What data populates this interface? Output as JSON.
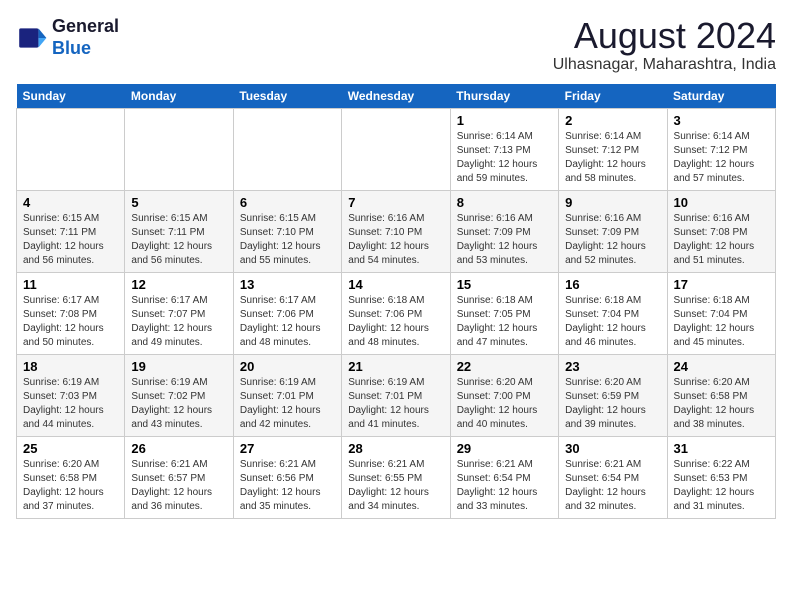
{
  "logo": {
    "line1": "General",
    "line2": "Blue"
  },
  "title": "August 2024",
  "subtitle": "Ulhasnagar, Maharashtra, India",
  "days_of_week": [
    "Sunday",
    "Monday",
    "Tuesday",
    "Wednesday",
    "Thursday",
    "Friday",
    "Saturday"
  ],
  "weeks": [
    [
      {
        "day": "",
        "info": ""
      },
      {
        "day": "",
        "info": ""
      },
      {
        "day": "",
        "info": ""
      },
      {
        "day": "",
        "info": ""
      },
      {
        "day": "1",
        "info": "Sunrise: 6:14 AM\nSunset: 7:13 PM\nDaylight: 12 hours\nand 59 minutes."
      },
      {
        "day": "2",
        "info": "Sunrise: 6:14 AM\nSunset: 7:12 PM\nDaylight: 12 hours\nand 58 minutes."
      },
      {
        "day": "3",
        "info": "Sunrise: 6:14 AM\nSunset: 7:12 PM\nDaylight: 12 hours\nand 57 minutes."
      }
    ],
    [
      {
        "day": "4",
        "info": "Sunrise: 6:15 AM\nSunset: 7:11 PM\nDaylight: 12 hours\nand 56 minutes."
      },
      {
        "day": "5",
        "info": "Sunrise: 6:15 AM\nSunset: 7:11 PM\nDaylight: 12 hours\nand 56 minutes."
      },
      {
        "day": "6",
        "info": "Sunrise: 6:15 AM\nSunset: 7:10 PM\nDaylight: 12 hours\nand 55 minutes."
      },
      {
        "day": "7",
        "info": "Sunrise: 6:16 AM\nSunset: 7:10 PM\nDaylight: 12 hours\nand 54 minutes."
      },
      {
        "day": "8",
        "info": "Sunrise: 6:16 AM\nSunset: 7:09 PM\nDaylight: 12 hours\nand 53 minutes."
      },
      {
        "day": "9",
        "info": "Sunrise: 6:16 AM\nSunset: 7:09 PM\nDaylight: 12 hours\nand 52 minutes."
      },
      {
        "day": "10",
        "info": "Sunrise: 6:16 AM\nSunset: 7:08 PM\nDaylight: 12 hours\nand 51 minutes."
      }
    ],
    [
      {
        "day": "11",
        "info": "Sunrise: 6:17 AM\nSunset: 7:08 PM\nDaylight: 12 hours\nand 50 minutes."
      },
      {
        "day": "12",
        "info": "Sunrise: 6:17 AM\nSunset: 7:07 PM\nDaylight: 12 hours\nand 49 minutes."
      },
      {
        "day": "13",
        "info": "Sunrise: 6:17 AM\nSunset: 7:06 PM\nDaylight: 12 hours\nand 48 minutes."
      },
      {
        "day": "14",
        "info": "Sunrise: 6:18 AM\nSunset: 7:06 PM\nDaylight: 12 hours\nand 48 minutes."
      },
      {
        "day": "15",
        "info": "Sunrise: 6:18 AM\nSunset: 7:05 PM\nDaylight: 12 hours\nand 47 minutes."
      },
      {
        "day": "16",
        "info": "Sunrise: 6:18 AM\nSunset: 7:04 PM\nDaylight: 12 hours\nand 46 minutes."
      },
      {
        "day": "17",
        "info": "Sunrise: 6:18 AM\nSunset: 7:04 PM\nDaylight: 12 hours\nand 45 minutes."
      }
    ],
    [
      {
        "day": "18",
        "info": "Sunrise: 6:19 AM\nSunset: 7:03 PM\nDaylight: 12 hours\nand 44 minutes."
      },
      {
        "day": "19",
        "info": "Sunrise: 6:19 AM\nSunset: 7:02 PM\nDaylight: 12 hours\nand 43 minutes."
      },
      {
        "day": "20",
        "info": "Sunrise: 6:19 AM\nSunset: 7:01 PM\nDaylight: 12 hours\nand 42 minutes."
      },
      {
        "day": "21",
        "info": "Sunrise: 6:19 AM\nSunset: 7:01 PM\nDaylight: 12 hours\nand 41 minutes."
      },
      {
        "day": "22",
        "info": "Sunrise: 6:20 AM\nSunset: 7:00 PM\nDaylight: 12 hours\nand 40 minutes."
      },
      {
        "day": "23",
        "info": "Sunrise: 6:20 AM\nSunset: 6:59 PM\nDaylight: 12 hours\nand 39 minutes."
      },
      {
        "day": "24",
        "info": "Sunrise: 6:20 AM\nSunset: 6:58 PM\nDaylight: 12 hours\nand 38 minutes."
      }
    ],
    [
      {
        "day": "25",
        "info": "Sunrise: 6:20 AM\nSunset: 6:58 PM\nDaylight: 12 hours\nand 37 minutes."
      },
      {
        "day": "26",
        "info": "Sunrise: 6:21 AM\nSunset: 6:57 PM\nDaylight: 12 hours\nand 36 minutes."
      },
      {
        "day": "27",
        "info": "Sunrise: 6:21 AM\nSunset: 6:56 PM\nDaylight: 12 hours\nand 35 minutes."
      },
      {
        "day": "28",
        "info": "Sunrise: 6:21 AM\nSunset: 6:55 PM\nDaylight: 12 hours\nand 34 minutes."
      },
      {
        "day": "29",
        "info": "Sunrise: 6:21 AM\nSunset: 6:54 PM\nDaylight: 12 hours\nand 33 minutes."
      },
      {
        "day": "30",
        "info": "Sunrise: 6:21 AM\nSunset: 6:54 PM\nDaylight: 12 hours\nand 32 minutes."
      },
      {
        "day": "31",
        "info": "Sunrise: 6:22 AM\nSunset: 6:53 PM\nDaylight: 12 hours\nand 31 minutes."
      }
    ]
  ]
}
